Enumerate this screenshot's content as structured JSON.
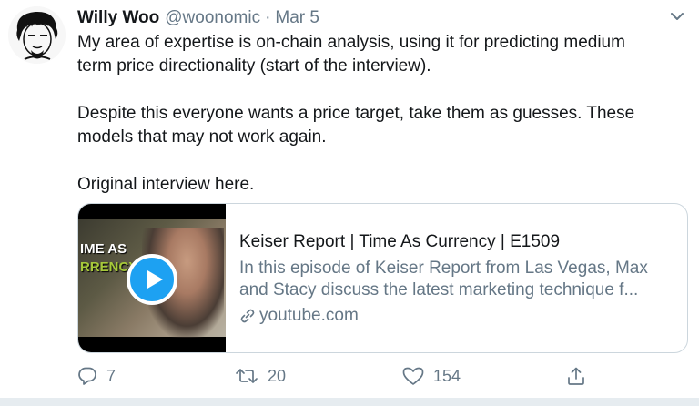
{
  "author": {
    "name": "Willy Woo",
    "handle": "@woonomic",
    "separator": "·",
    "date": "Mar 5"
  },
  "body": {
    "paragraph1_line1": "My area of expertise is on-chain analysis, using it for predicting medium",
    "paragraph1_line2": "term price directionality (start of the interview).",
    "paragraph2_line1": "Despite this everyone wants a price target, take them as guesses. These",
    "paragraph2_line2": "models that may not work again.",
    "paragraph3": "Original interview here."
  },
  "card": {
    "thumbnail_text_line1": "IME AS",
    "thumbnail_text_line2": "RRENCY",
    "title": "Keiser Report | Time As Currency | E1509",
    "description_line1": "In this episode of Keiser Report from Las Vegas, Max",
    "description_line2": "and Stacy discuss the latest marketing technique f...",
    "domain": "youtube.com",
    "play_icon": "play-icon",
    "link_icon": "link-icon"
  },
  "actions": {
    "reply_count": "7",
    "retweet_count": "20",
    "like_count": "154",
    "reply_icon": "reply-icon",
    "retweet_icon": "retweet-icon",
    "like_icon": "heart-icon",
    "share_icon": "share-icon"
  },
  "colors": {
    "text": "#14171a",
    "secondary": "#657786",
    "accent": "#1da1f2",
    "border": "#ccd6dd"
  }
}
